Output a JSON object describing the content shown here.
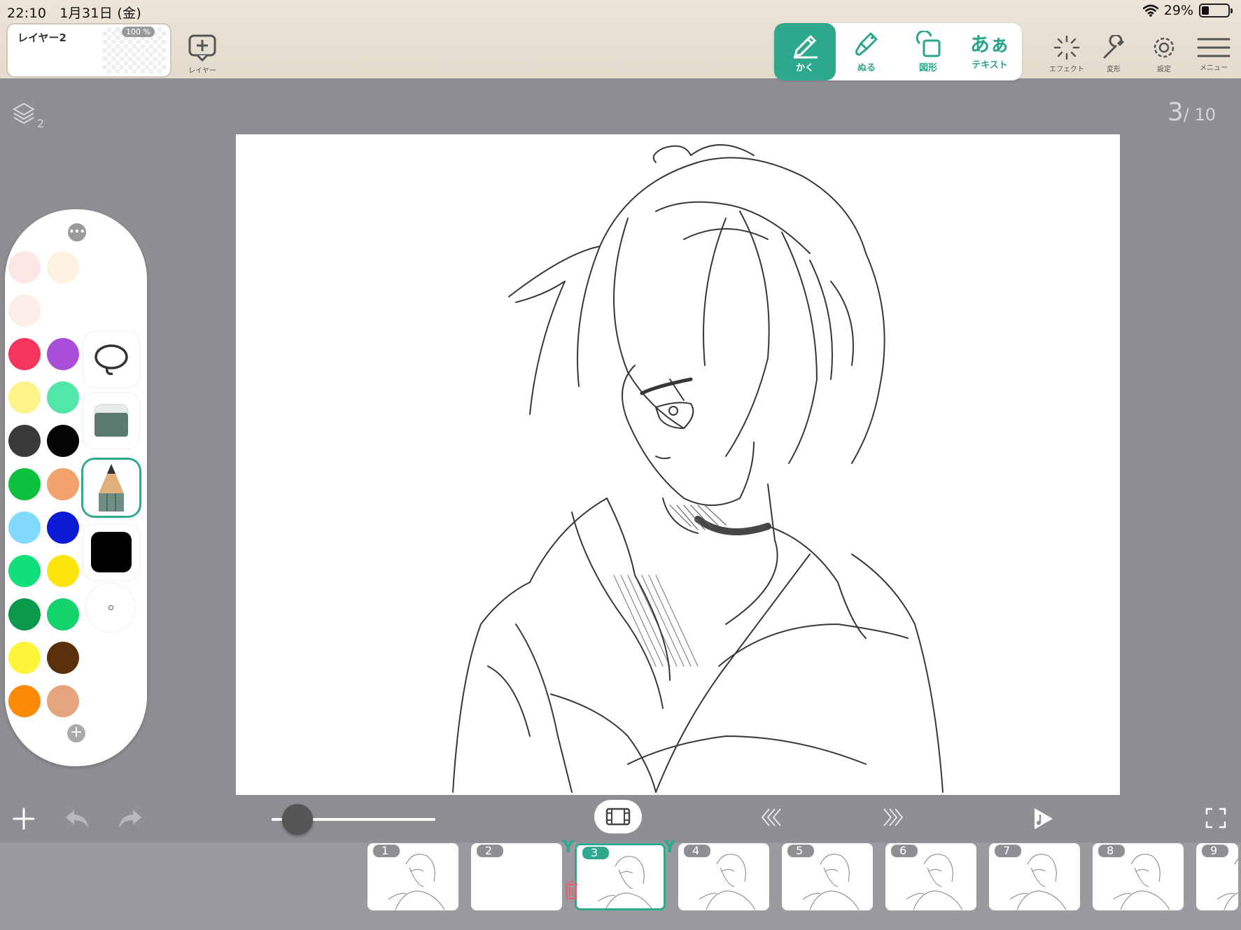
{
  "status": {
    "time": "22:10",
    "date": "1月31日 (金)",
    "battery": "29%"
  },
  "layer_chip": {
    "name": "レイヤー2",
    "opacity": "100 %"
  },
  "add_layer": {
    "label": "レイヤー"
  },
  "tools": [
    {
      "label": "かく",
      "active": true
    },
    {
      "label": "ぬる",
      "active": false
    },
    {
      "label": "図形",
      "active": false
    },
    {
      "label": "テキスト",
      "glyph": "あぁ",
      "active": false
    }
  ],
  "top_actions": [
    {
      "label": "エフェクト",
      "icon": "sparkle-icon"
    },
    {
      "label": "変形",
      "icon": "wrench-icon"
    },
    {
      "label": "設定",
      "icon": "gear-icon"
    },
    {
      "label": "メニュー",
      "icon": "hamburger-icon"
    }
  ],
  "layers_indicator": {
    "count": "2"
  },
  "frame_counter": {
    "current": "3",
    "total": "/ 10"
  },
  "palette": {
    "more_label": "•••",
    "colors": [
      "#fce6e6",
      "#fdf2df",
      "#fcefe8",
      "#ffffff",
      "#f5365c",
      "#a94ed8",
      "#faf48a",
      "#52e6a8",
      "#3a3a3a",
      "#050505",
      "#0cc23c",
      "#f3a46c",
      "#7fdafb",
      "#0c1ad6",
      "#10e07c",
      "#fde40a",
      "#0b9a4c",
      "#12d36c",
      "#fdf43c",
      "#5a2f0b",
      "#fb8a08",
      "#e3a47e"
    ],
    "current_color": "#000000",
    "add_label": "+"
  },
  "brush": {
    "opacity_percent": 10
  },
  "frames": [
    {
      "num": "1"
    },
    {
      "num": "2"
    },
    {
      "num": "3",
      "selected": true
    },
    {
      "num": "4"
    },
    {
      "num": "5"
    },
    {
      "num": "6"
    },
    {
      "num": "7"
    },
    {
      "num": "8"
    },
    {
      "num": "9"
    }
  ],
  "accent": "#2fa98e"
}
